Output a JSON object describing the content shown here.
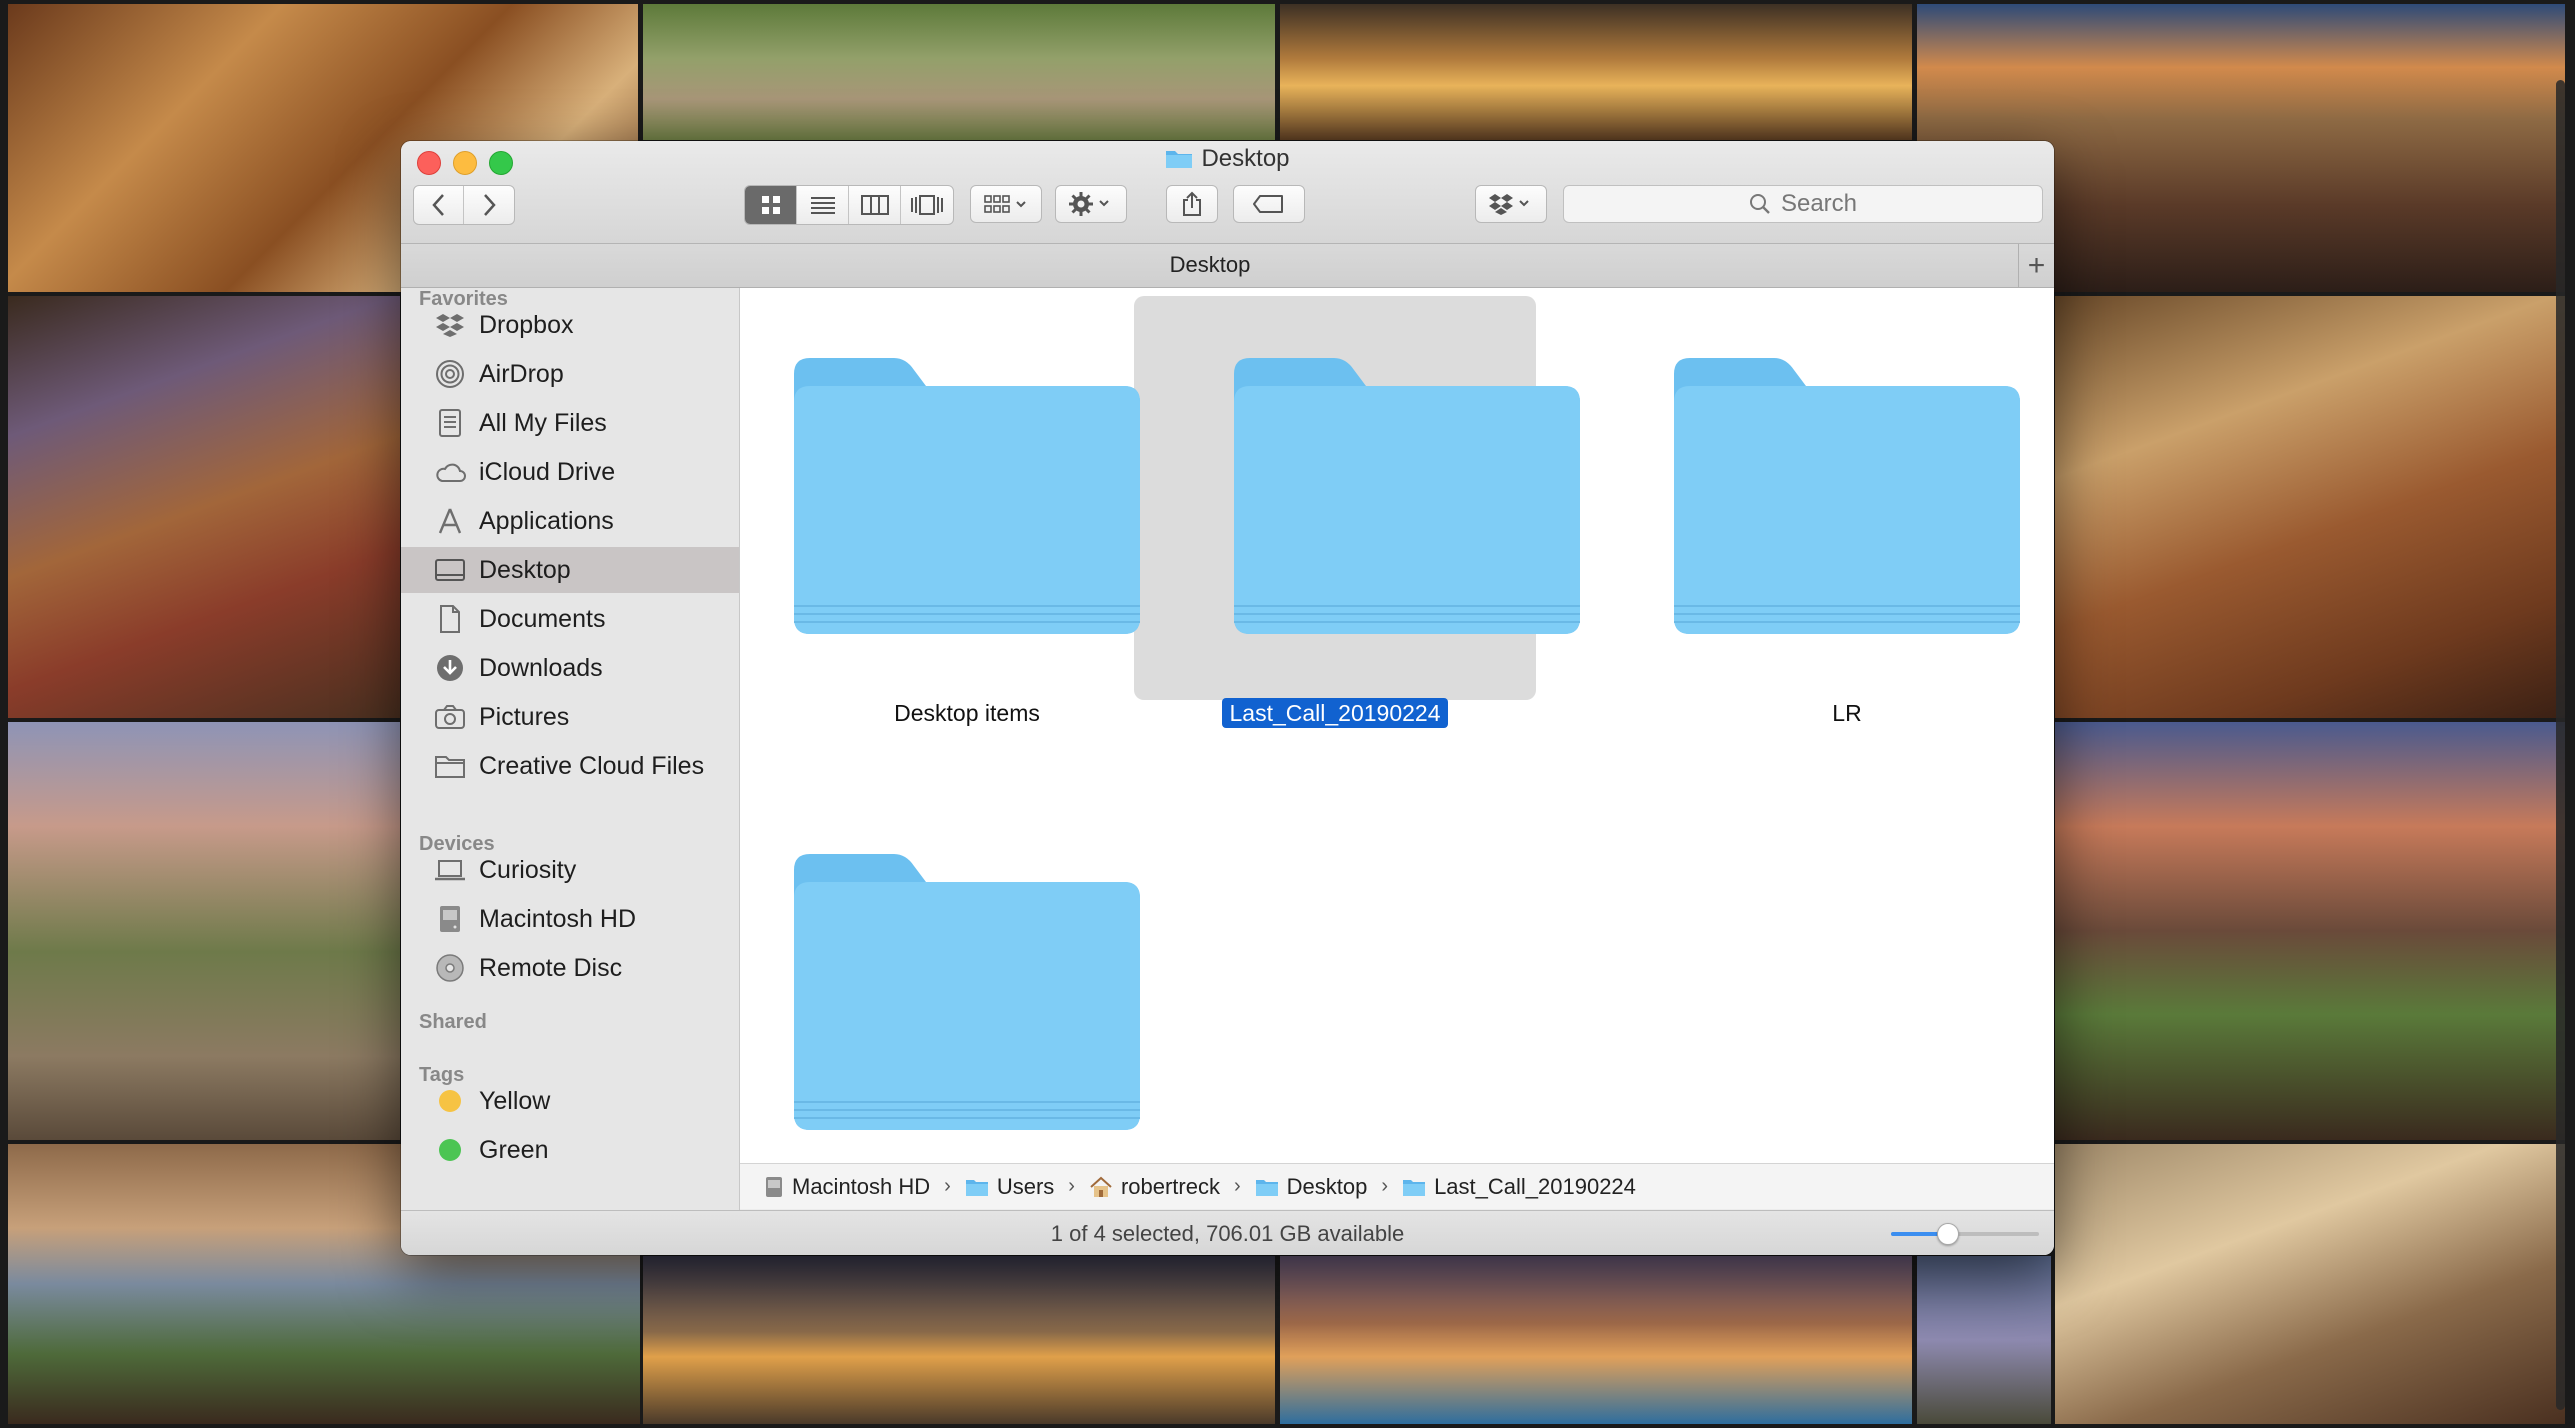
{
  "window": {
    "title": "Desktop"
  },
  "toolbar": {
    "search_placeholder": "Search"
  },
  "tab": {
    "label": "Desktop",
    "add_label": "+"
  },
  "sidebar": {
    "favorites_header": "Favorites",
    "favorites": [
      "Dropbox",
      "AirDrop",
      "All My Files",
      "iCloud Drive",
      "Applications",
      "Desktop",
      "Documents",
      "Downloads",
      "Pictures",
      "Creative Cloud Files"
    ],
    "devices_header": "Devices",
    "devices": [
      "Curiosity",
      "Macintosh HD",
      "Remote Disc"
    ],
    "shared_header": "Shared",
    "tags_header": "Tags",
    "tags": [
      {
        "name": "Yellow",
        "color": "#f6c343"
      },
      {
        "name": "Green",
        "color": "#4cc553"
      }
    ]
  },
  "folders": [
    "Desktop items",
    "Last_Call_20190224",
    "LR",
    ""
  ],
  "pathbar": [
    "Macintosh HD",
    "Users",
    "robertreck",
    "Desktop",
    "Last_Call_20190224"
  ],
  "status": {
    "text": "1 of 4 selected, 706.01 GB available",
    "icon_size_level": 0.38
  },
  "colors": {
    "folder": "#7fcdf6",
    "selection": "#1162d0",
    "sidebar_selection": "#c9c5c5"
  }
}
